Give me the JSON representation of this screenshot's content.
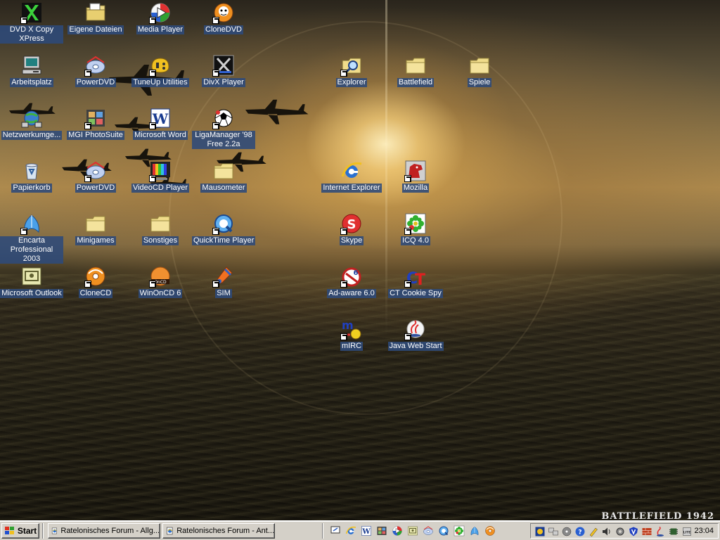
{
  "desktop": {
    "icons": [
      {
        "label": "DVD X Copy XPress",
        "icon": "dvd-x-copy-icon",
        "shortcut": true
      },
      {
        "label": "Eigene Dateien",
        "icon": "my-documents-icon",
        "shortcut": false
      },
      {
        "label": "Media Player",
        "icon": "media-player-icon",
        "shortcut": true
      },
      {
        "label": "CloneDVD",
        "icon": "clonedvd-icon",
        "shortcut": true
      },
      {
        "label": "Arbeitsplatz",
        "icon": "my-computer-icon",
        "shortcut": false
      },
      {
        "label": "PowerDVD",
        "icon": "powerdvd-icon",
        "shortcut": true
      },
      {
        "label": "TuneUp Utilities",
        "icon": "tuneup-icon",
        "shortcut": true
      },
      {
        "label": "DivX Player",
        "icon": "divx-icon",
        "shortcut": true
      },
      {
        "label": "Explorer",
        "icon": "explorer-icon",
        "shortcut": true
      },
      {
        "label": "Battlefield",
        "icon": "folder-icon",
        "shortcut": false
      },
      {
        "label": "Spiele",
        "icon": "folder-icon",
        "shortcut": false
      },
      {
        "label": "Netzwerkumge...",
        "icon": "network-icon",
        "shortcut": false
      },
      {
        "label": "MGI PhotoSuite",
        "icon": "photosuite-icon",
        "shortcut": true
      },
      {
        "label": "Microsoft Word",
        "icon": "word-icon",
        "shortcut": true
      },
      {
        "label": "LigaManager '98 Free 2.2a",
        "icon": "ligamanager-icon",
        "shortcut": true
      },
      {
        "label": "Papierkorb",
        "icon": "recycle-bin-icon",
        "shortcut": false
      },
      {
        "label": "PowerDVD",
        "icon": "powerdvd-icon",
        "shortcut": true
      },
      {
        "label": "VideoCD Player",
        "icon": "videocd-icon",
        "shortcut": true
      },
      {
        "label": "Mausometer",
        "icon": "folder-icon",
        "shortcut": false
      },
      {
        "label": "Internet Explorer",
        "icon": "internet-explorer-icon",
        "shortcut": false
      },
      {
        "label": "Mozilla",
        "icon": "mozilla-icon",
        "shortcut": true
      },
      {
        "label": "Encarta Professional 2003",
        "icon": "encarta-icon",
        "shortcut": true
      },
      {
        "label": "Minigames",
        "icon": "folder-icon",
        "shortcut": false
      },
      {
        "label": "Sonstiges",
        "icon": "folder-icon",
        "shortcut": false
      },
      {
        "label": "QuickTime Player",
        "icon": "quicktime-icon",
        "shortcut": true
      },
      {
        "label": "Skype",
        "icon": "skype-icon",
        "shortcut": true
      },
      {
        "label": "ICQ 4.0",
        "icon": "icq-icon",
        "shortcut": true
      },
      {
        "label": "Microsoft Outlook",
        "icon": "outlook-icon",
        "shortcut": false
      },
      {
        "label": "CloneCD",
        "icon": "clonecd-icon",
        "shortcut": true
      },
      {
        "label": "WinOnCD 6",
        "icon": "winoncd-icon",
        "shortcut": true
      },
      {
        "label": "SIM",
        "icon": "sim-icon",
        "shortcut": true
      },
      {
        "label": "Ad-aware 6.0",
        "icon": "adaware-icon",
        "shortcut": true
      },
      {
        "label": "CT Cookie Spy",
        "icon": "cookie-spy-icon",
        "shortcut": true
      },
      {
        "label": "mIRC",
        "icon": "mirc-icon",
        "shortcut": true
      },
      {
        "label": "Java Web Start",
        "icon": "java-web-start-icon",
        "shortcut": true
      }
    ],
    "brand_text": "BATTLEFIELD 1942"
  },
  "taskbar": {
    "start_label": "Start",
    "tasks": [
      {
        "label": "Ratelonisches Forum - Allg...",
        "icon": "ie-page-icon"
      },
      {
        "label": "Ratelonisches Forum - Ant...",
        "icon": "ie-page-icon"
      }
    ],
    "quick_launch_icons": [
      "show-desktop-icon",
      "internet-explorer-icon",
      "word-icon",
      "photosuite-icon",
      "media-player-icon",
      "outlook-icon",
      "powerdvd-icon",
      "quicktime-icon",
      "icq-icon",
      "encarta-icon",
      "clonecd-icon"
    ],
    "tray_icons": [
      "antivirus-icon",
      "network-tray-icon",
      "disc-tray-icon",
      "help-tray-icon",
      "pen-tray-icon",
      "speaker-tray-icon",
      "settings-tray-icon",
      "shield-tray-icon",
      "firewall-tray-icon",
      "java-tray-icon",
      "chip-tray-icon",
      "cpu-tray-icon"
    ],
    "clock": "23:04"
  },
  "colors": {
    "label_bg": "#2e4a7a",
    "taskbar": "#d4d0c8",
    "folder": "#f0dc8a"
  }
}
